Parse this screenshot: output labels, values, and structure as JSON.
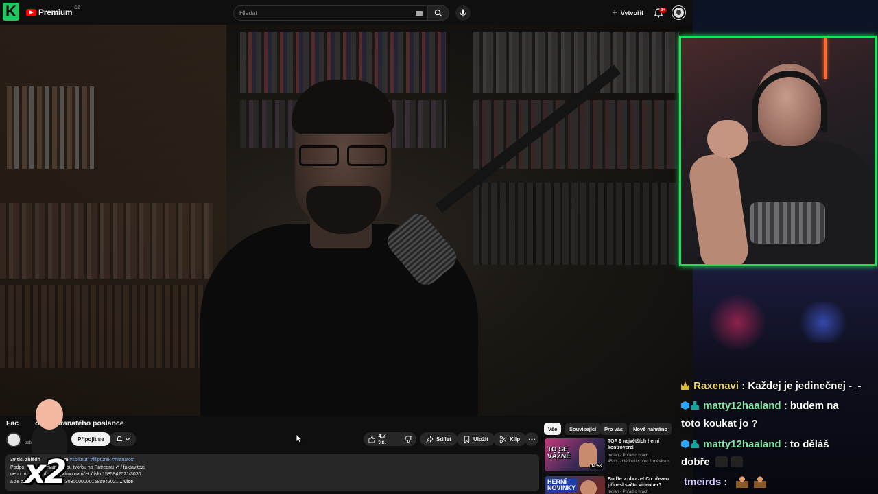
{
  "topbar": {
    "brand": "Premium",
    "region": "CZ",
    "search_placeholder": "Hledat",
    "create_label": "Vytvořit",
    "notif_count": "9+"
  },
  "video": {
    "title_left": "Fac",
    "title_mid": "ok",
    "title_right": "hranatého poslance",
    "channel_subs": "odběratelů",
    "join_label": "Připojit se",
    "likes": "4,7 tis.",
    "share_label": "Sdílet",
    "save_label": "Uložit",
    "clip_label": "Klip"
  },
  "description": {
    "line1_meta": "39 tis. zhlédn",
    "line1_meta2": "1 dnem",
    "line1_tags": "#spiknutí #filipturek #hranatost",
    "line2": "Podpo",
    "line2b": "onálně živou tvorbu na Patreonu",
    "line2_link": "✔ / faktavitezi",
    "line3": "nebo m",
    "line3b": "žete",
    "line3c": "přispět i přímo na účet číslo 1585942021/3030",
    "line4": "a ze za",
    "line4b": "CZ8230300000001585942021",
    "more": "...více"
  },
  "chips": [
    "Vše",
    "Související",
    "Pro vás",
    "Nově nahráno"
  ],
  "recs": [
    {
      "title": "TOP 9 největších herní kontroverzí",
      "channel": "Indian - Pořád o hrách",
      "meta": "45 tis. zhlédnutí • před 1 měsícem",
      "duration": "14:56",
      "thumb_text": "TO SE VÁŽNĚ"
    },
    {
      "title": "Buďte v obraze! Co březen přinesl světu videoher?",
      "channel": "Indian - Pořád o hrách",
      "meta": "",
      "duration": "",
      "thumb_text": "HERNÍ NOVINKY"
    }
  ],
  "overlay": {
    "multiplier": "x2"
  },
  "chat": [
    {
      "user": "Raxenavi",
      "text": ": Každej je jedinečnej -_-",
      "badge": "crown",
      "cls": "u-rax"
    },
    {
      "user": "matty12haaland",
      "text": ": budem na",
      "badge": "cube",
      "cls": "u-matty"
    },
    {
      "user": "",
      "text": "toto koukat jo ?",
      "badge": "",
      "cls": ""
    },
    {
      "user": "matty12haaland",
      "text": ": to děláš",
      "badge": "cube",
      "cls": "u-matty"
    },
    {
      "user": "",
      "text": "dobře",
      "badge": "",
      "cls": ""
    },
    {
      "user": "tmeirds",
      "text": ":",
      "badge": "",
      "cls": "u-tm"
    }
  ],
  "colors": {
    "accent_green": "#22e05a",
    "yt_red": "#ff0000",
    "kick_green": "#22c55e"
  }
}
